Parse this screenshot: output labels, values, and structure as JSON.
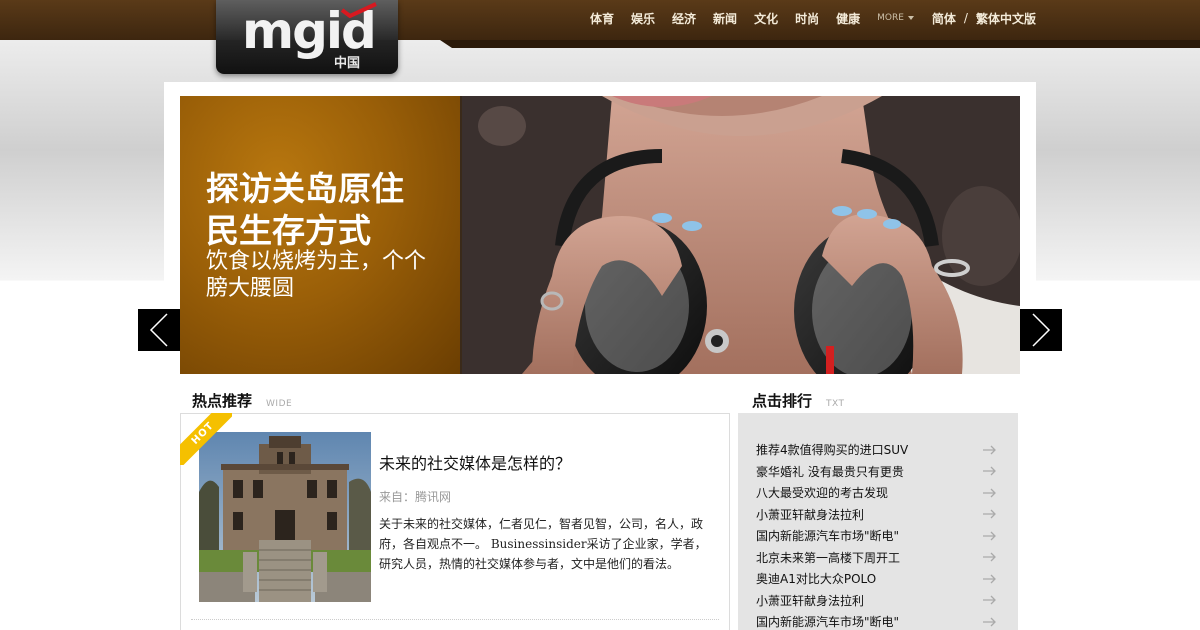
{
  "logo": {
    "wordmark": "mgid",
    "sub": "中国"
  },
  "nav": {
    "items": [
      "体育",
      "娱乐",
      "经济",
      "新闻",
      "文化",
      "时尚",
      "健康"
    ],
    "more": "MORE",
    "lang_simplified": "简体",
    "lang_sep": "/",
    "lang_traditional": "繁体中文版"
  },
  "hero": {
    "title": "探访关岛原住民生存方式",
    "subtitle": "饮食以烧烤为主，个个膀大腰圆"
  },
  "hot_section": {
    "title": "热点推荐",
    "tag": "WIDE"
  },
  "rank_section": {
    "title": "点击排行",
    "tag": "TXT"
  },
  "featured": {
    "badge": "HOT",
    "headline": "未来的社交媒体是怎样的？",
    "source": "来自：腾讯网",
    "description": "关于未来的社交媒体，仁者见仁，智者见智，公司，名人，政府，各自观点不一。 Businessinsider采访了企业家，学者，研究人员，热情的社交媒体参与者，文中是他们的看法。"
  },
  "rank_items": [
    "推荐4款值得购买的进口SUV",
    "豪华婚礼 没有最贵只有更贵",
    "八大最受欢迎的考古发现",
    "小萧亚轩献身法拉利",
    "国内新能源汽车市场\"断电\"",
    "北京未来第一高楼下周开工",
    "奥迪A1对比大众POLO",
    "小萧亚轩献身法拉利",
    "国内新能源汽车市场\"断电\""
  ],
  "colors": {
    "header": "#4a2f13",
    "hero_panel": "#9a5f08",
    "hot_ribbon": "#f5c000",
    "rank_bg": "#e4e4e4"
  }
}
